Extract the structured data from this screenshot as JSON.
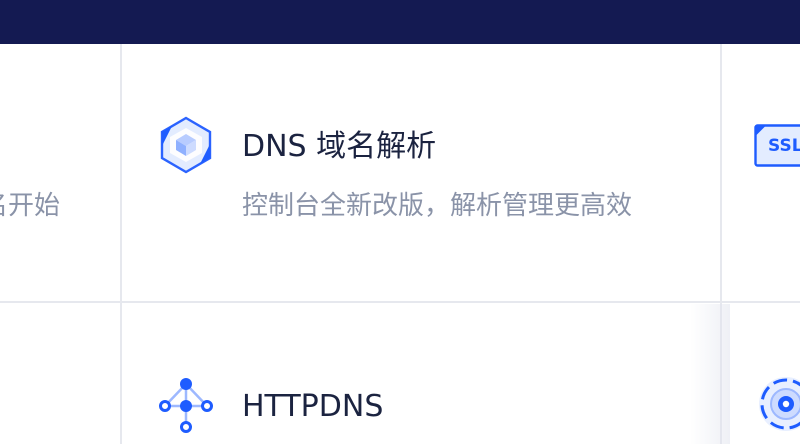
{
  "cards": {
    "left_top": {
      "desc": "名开始"
    },
    "dns": {
      "title": "DNS 域名解析",
      "desc": "控制台全新改版，解析管理更高效",
      "icon": "dns-cube-icon"
    },
    "httpdns": {
      "title": "HTTPDNS",
      "icon": "network-node-icon"
    },
    "ssl": {
      "badge": "SSL",
      "icon": "ssl-certificate-icon"
    },
    "right_bottom": {
      "icon": "target-icon"
    }
  },
  "colors": {
    "topbar": "#141a52",
    "accent": "#1e5cff",
    "title": "#1b2340",
    "desc": "#8a93a8",
    "grid": "#e6e8ee"
  }
}
